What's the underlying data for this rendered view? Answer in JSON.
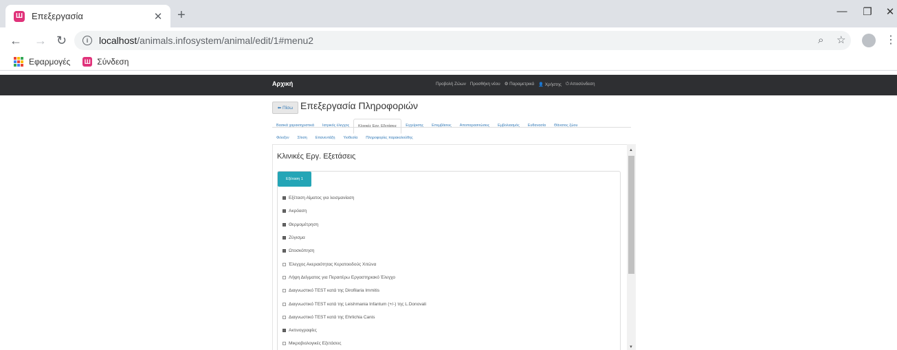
{
  "browser": {
    "tab_title": "Επεξεργασία",
    "tab_favicon_letter": "Ш",
    "url_host": "localhost",
    "url_path": "/animals.infosystem/animal/edit/1#menu2",
    "bookmarks": [
      {
        "label": "Εφαρμογές",
        "icon": "apps-grid-icon"
      },
      {
        "label": "Σύνδεση",
        "icon": "site-favicon"
      }
    ],
    "accent": "#e0327a"
  },
  "navbar": {
    "brand": "Αρχική",
    "links": [
      "Προβολή Ζώων",
      "Προσθήκη νέου",
      "⚙ Παραμετρικά",
      "👤 Χρήστης",
      "⏻ Αποσύνδεση"
    ]
  },
  "page": {
    "back_label": "⬅ Πίσω",
    "title": "Επεξεργασία Πληροφοριών",
    "tabs_row1": [
      "Βασικά χαρακτηριστικά",
      "Ιατρικός έλεγχος",
      "Κλινικές Εργ. Εξετάσεις",
      "Εγχείρισης",
      "Επεμβάσεις",
      "Αποπαρασιτώσεις",
      "Εμβολιασμός",
      "Ευθανασία",
      "Θάνατος ζώου"
    ],
    "tabs_row2": [
      "Φιλοξεν",
      "Σίτιση",
      "Επανεντάξη",
      "Υιοθεσία",
      "Πληροφορίες παρακολούθης"
    ],
    "active_tab": "Κλινικές Εργ. Εξετάσεις",
    "section_title": "Κλινικές Εργ. Εξετάσεις",
    "panel_tab_label": "Εξέταση 1",
    "panel_tab_color": "#24a5b6",
    "checks": [
      {
        "label": "Εξέταση Αίματος για λεισμανίαση",
        "checked": true
      },
      {
        "label": "Ακρόαση",
        "checked": true
      },
      {
        "label": "Θερμομέτρηση",
        "checked": true
      },
      {
        "label": "Ζύγισμα",
        "checked": true
      },
      {
        "label": "Ωτοσκόπηση",
        "checked": true
      },
      {
        "label": "Έλεγχος Ακεραιότητας Κερατοειδούς Χιτώνα",
        "checked": false
      },
      {
        "label": "Λήψη Δείγματος για Περαιτέρω Εργαστηριακό Έλεγχο",
        "checked": false
      },
      {
        "label": "Διαγνωστικό TEST κατά της Dirofilaria Immitis",
        "checked": false
      },
      {
        "label": "Διαγνωστικό TEST κατά της Leishmania Infantum (+/-) της L.Donovali",
        "checked": false
      },
      {
        "label": "Διαγνωστικό TEST κατά της Ehrlichia Canis",
        "checked": false
      },
      {
        "label": "Ακτινογραφίες",
        "checked": true
      },
      {
        "label": "Μικροβιολογικές Εξετάσεις",
        "checked": false
      }
    ]
  }
}
